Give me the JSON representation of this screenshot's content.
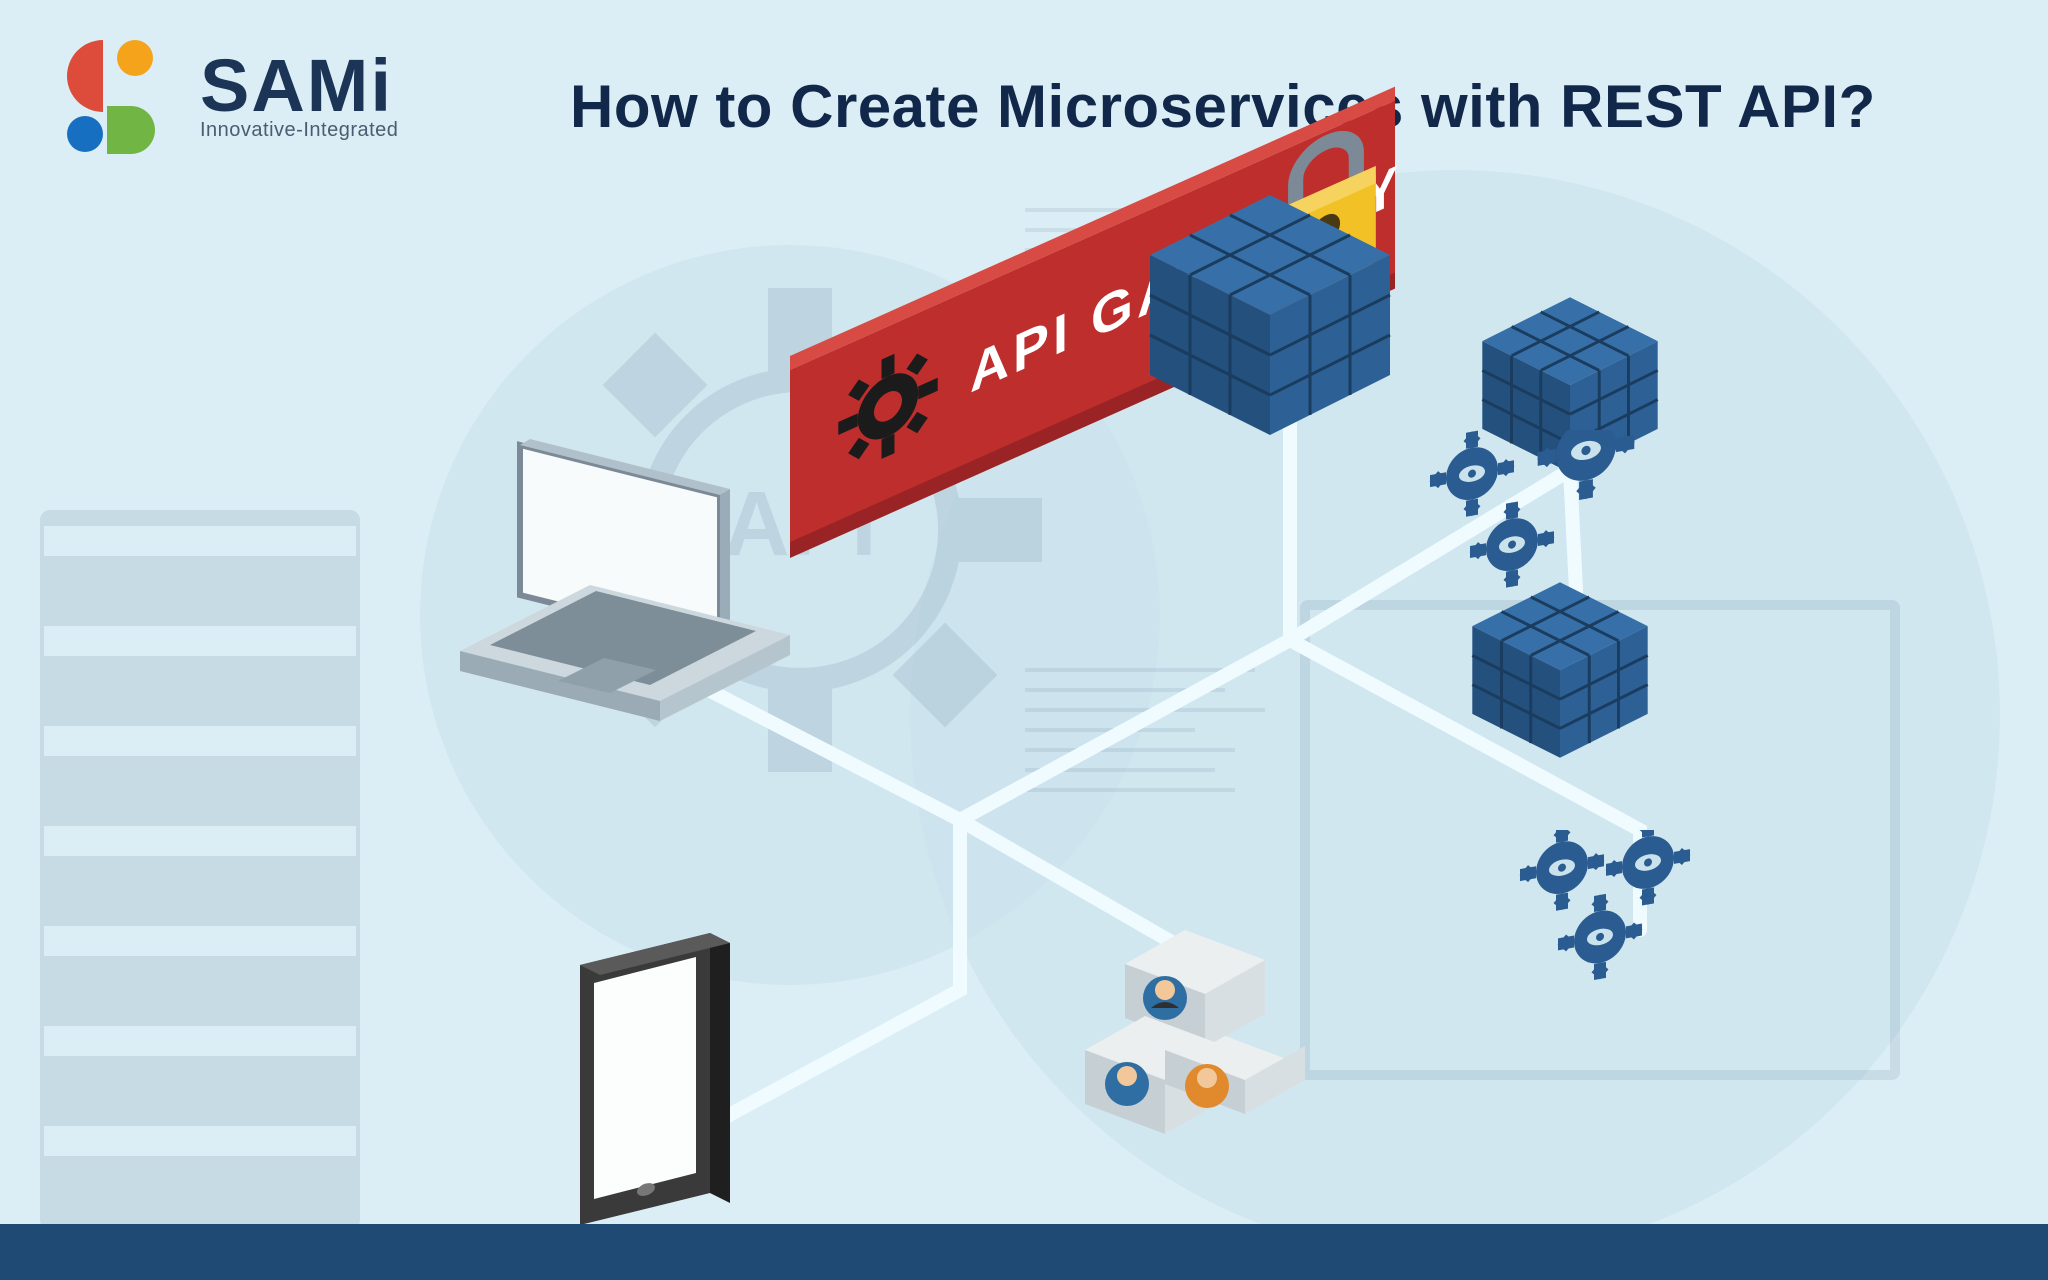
{
  "brand": {
    "name": "SAMi",
    "tagline": "Innovative-Integrated"
  },
  "title": "How to Create Microservices with REST API?",
  "diagram": {
    "gateway_label": "API GATE WAY",
    "gateway_color": "#be2e2d",
    "gateway_icon_left": "gear-icon",
    "gateway_icon_right": "lock-icon",
    "cube_color": "#2a5c91",
    "gear_color": "#2a5c91",
    "nodes": [
      {
        "id": "laptop",
        "label": "client-laptop"
      },
      {
        "id": "phone",
        "label": "client-mobile"
      },
      {
        "id": "gateway",
        "label": "api-gateway"
      },
      {
        "id": "service-cube-large",
        "label": "microservice-cluster-1"
      },
      {
        "id": "service-cube-mid",
        "label": "microservice-cluster-2"
      },
      {
        "id": "service-cube-small",
        "label": "microservice-cluster-3"
      },
      {
        "id": "gears-cluster-top",
        "label": "processing-services-1"
      },
      {
        "id": "gears-cluster-bottom",
        "label": "processing-services-2"
      },
      {
        "id": "users",
        "label": "user-directory"
      }
    ],
    "background_elements": [
      "server-rack",
      "api-gear-watermark",
      "code-block",
      "monitor-frame"
    ]
  }
}
